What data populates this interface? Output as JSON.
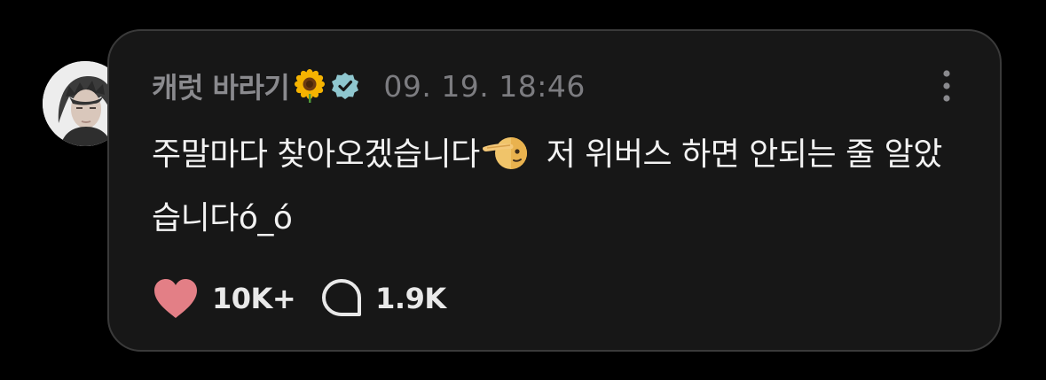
{
  "post": {
    "author_name": "캐럿 바라기",
    "author_emoji": "sunflower-icon",
    "verified": true,
    "timestamp": "09. 19. 18:46",
    "text_part1": "주말마다 찾아오겠습니다",
    "inline_emoji": "saluting-face-icon",
    "text_part2": " 저 위버스 하면 안되는 줄 알았습니다ó_ó",
    "likes_count": "10K+",
    "comments_count": "1.9K"
  },
  "colors": {
    "background": "#000000",
    "card": "#171717",
    "card_border": "#3a3a3a",
    "heart": "#e37f86",
    "verified_badge": "#8fc7cf",
    "text_primary": "#f2f2f2",
    "text_secondary": "#8a8a8e"
  }
}
